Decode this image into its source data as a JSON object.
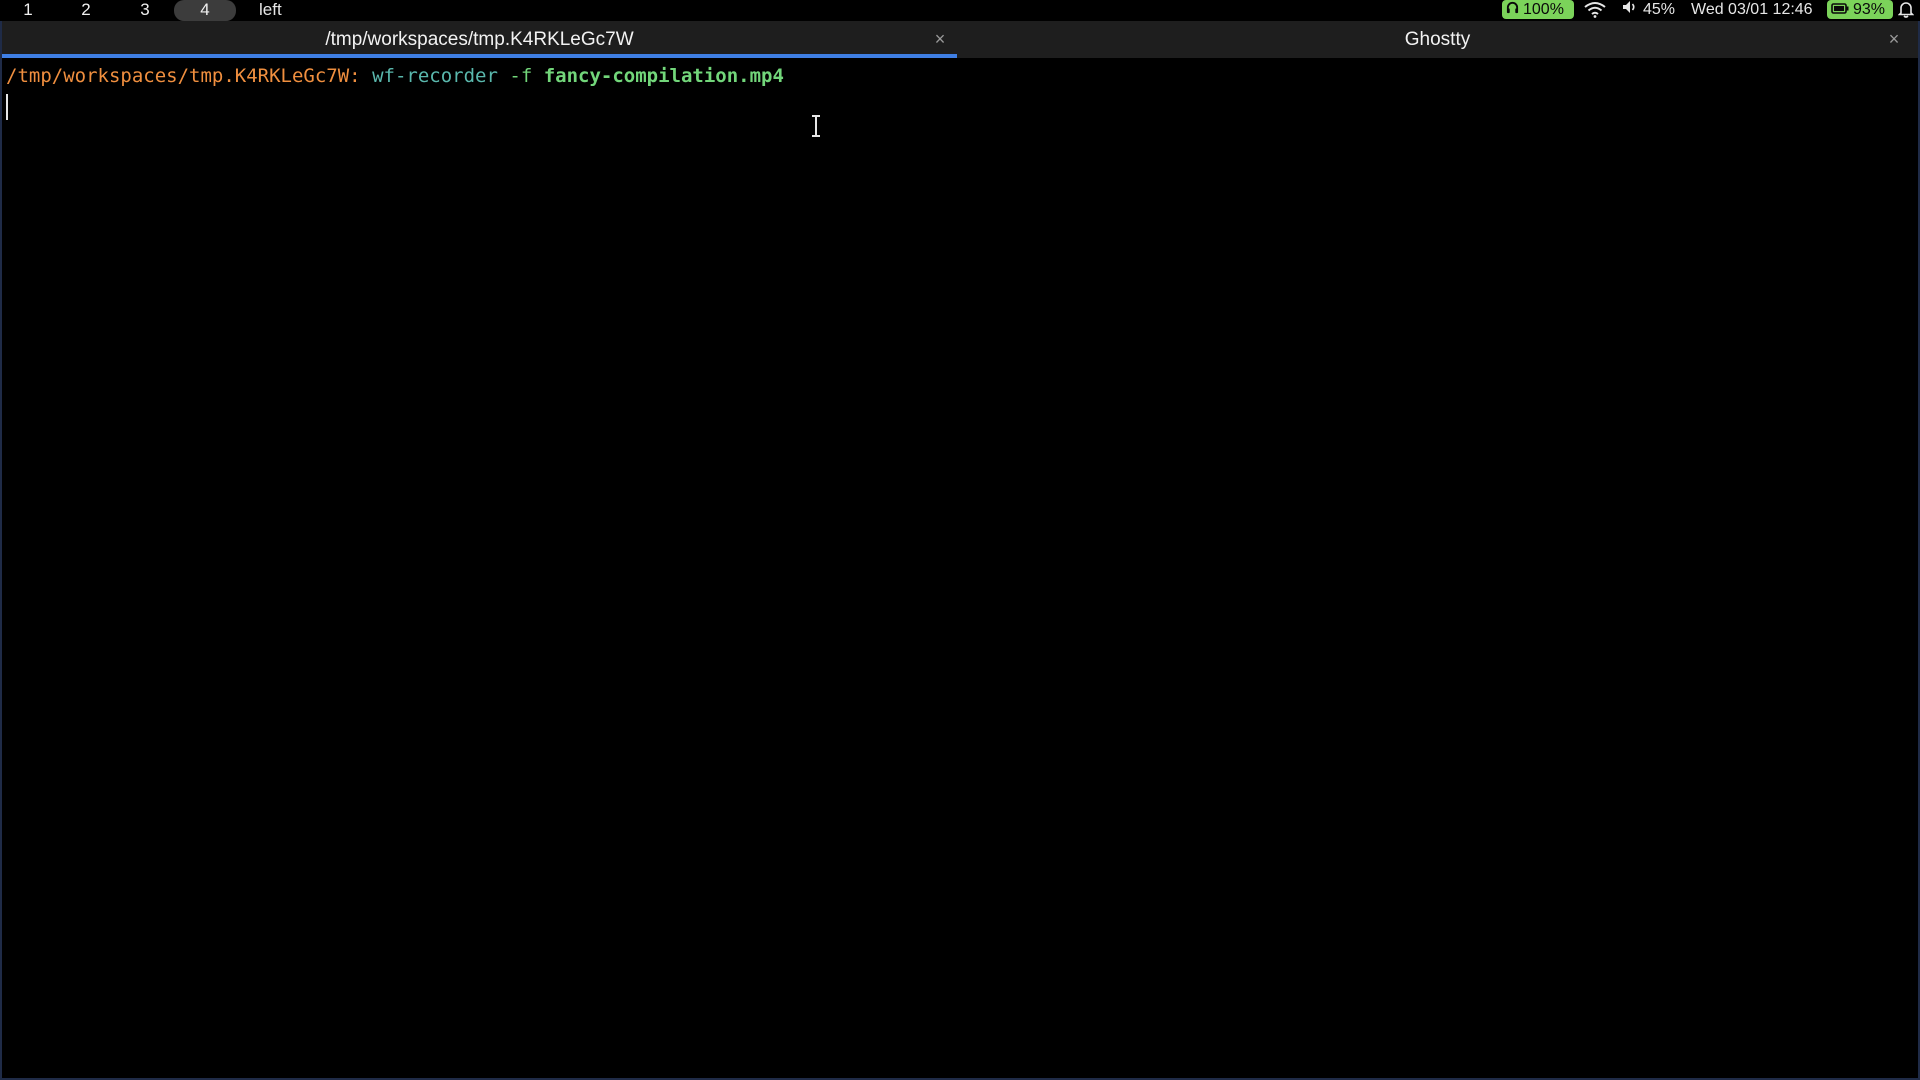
{
  "statusbar": {
    "workspaces": [
      {
        "label": "1",
        "active": false
      },
      {
        "label": "2",
        "active": false
      },
      {
        "label": "3",
        "active": false
      },
      {
        "label": "4",
        "active": true
      }
    ],
    "layout": "left",
    "headset": {
      "icon": "headphones-icon",
      "value": "100%"
    },
    "wifi": {
      "icon": "wifi-icon"
    },
    "volume": {
      "icon": "speaker-icon",
      "value": "45%"
    },
    "clock": "Wed 03/01 12:46",
    "battery": {
      "icon": "battery-icon",
      "value": "93%"
    },
    "notifications": {
      "icon": "bell-icon"
    },
    "colors": {
      "accent_pill": "#7bd35a",
      "active_workspace": "#3c3c3c"
    }
  },
  "window": {
    "tabs": [
      {
        "title": "/tmp/workspaces/tmp.K4RKLeGc7W",
        "active": true,
        "close": "×"
      },
      {
        "title": "Ghostty",
        "active": false,
        "close": "×"
      }
    ],
    "active_tab_color": "#3f7fe4"
  },
  "terminal": {
    "prompt_path": "/tmp/workspaces/tmp.K4RKLeGc7W",
    "prompt_sep": ":",
    "command": "wf-recorder",
    "flag": "-f",
    "argument": "fancy-compilation.mp4",
    "colors": {
      "path": "#f08f3f",
      "command": "#5ab8ad",
      "args": "#72d67a"
    }
  }
}
